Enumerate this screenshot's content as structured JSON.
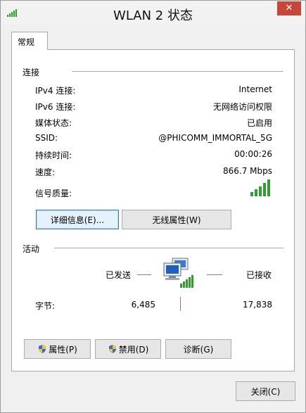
{
  "window": {
    "title": "WLAN 2 状态",
    "close_glyph": "✕"
  },
  "tab": {
    "label": "常规"
  },
  "connection": {
    "section_title": "连接",
    "rows": [
      {
        "label": "IPv4 连接:",
        "value": "Internet"
      },
      {
        "label": "IPv6 连接:",
        "value": "无网络访问权限"
      },
      {
        "label": "媒体状态:",
        "value": "已启用"
      },
      {
        "label": "SSID:",
        "value": "@PHICOMM_IMMORTAL_5G"
      },
      {
        "label": "持续时间:",
        "value": "00:00:26"
      },
      {
        "label": "速度:",
        "value": "866.7 Mbps"
      },
      {
        "label": "信号质量:",
        "value": ""
      }
    ],
    "signal_bars": 5,
    "details_button": "详细信息(E)...",
    "wireless_button": "无线属性(W)"
  },
  "activity": {
    "section_title": "活动",
    "sent_label": "已发送",
    "received_label": "已接收",
    "bytes_label": "字节:",
    "bytes_sent": "6,485",
    "bytes_received": "17,838"
  },
  "buttons": {
    "properties": "属性(P)",
    "disable": "禁用(D)",
    "diagnose": "诊断(G)",
    "close": "关闭(C)"
  },
  "colors": {
    "signal": "#2e9e2e",
    "close_red": "#c7463a"
  },
  "icons": {
    "title": "wifi-signal-icon",
    "network": "network-computers-icon",
    "shield": "uac-shield-icon"
  }
}
